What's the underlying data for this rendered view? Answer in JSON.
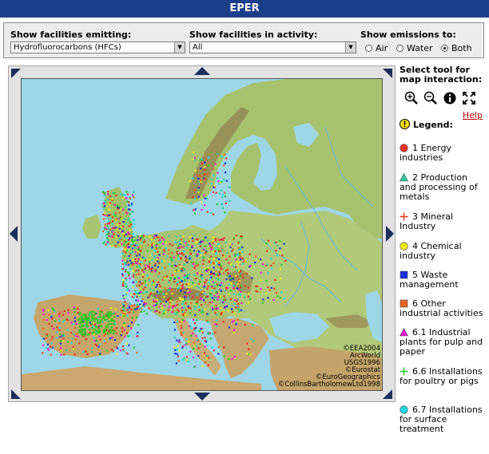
{
  "app": {
    "title": "EPER"
  },
  "filters": {
    "pollutant": {
      "label": "Show facilities emitting:",
      "value": "Hydrofluorocarbons (HFCs)"
    },
    "activity": {
      "label": "Show facilities in activity:",
      "value": "All"
    },
    "emissions": {
      "label": "Show emissions to:",
      "options": [
        "Air",
        "Water",
        "Both"
      ],
      "selected": "Both"
    }
  },
  "map": {
    "credits": [
      "©EEA2004",
      "ArcWorld",
      "USGS1996",
      "©Eurostat",
      "©EuroGeographics",
      "©CollinsBartholomewLtd1998"
    ],
    "colors": {
      "sea": "#9ed6e8",
      "lowland": "#a7c26f",
      "highland": "#c9a873",
      "mountain": "#8c5f3a",
      "river": "#5fb6e4"
    }
  },
  "sidebar": {
    "tool_heading": "Select tool for map interaction:",
    "tools": [
      "zoom-in-icon",
      "zoom-out-icon",
      "info-icon",
      "full-extent-icon"
    ],
    "help_label": "Help",
    "legend_title": "Legend:",
    "legend": [
      {
        "label": "1 Energy industries",
        "symbol": "circle",
        "color": "#e8321e"
      },
      {
        "label": "2 Production and processing of metals",
        "symbol": "triangle",
        "color": "#2ec9a0"
      },
      {
        "label": "3 Mineral Industry",
        "symbol": "plus",
        "color": "#e8321e"
      },
      {
        "label": "4 Chemical industry",
        "symbol": "circle",
        "color": "#f2ee1a"
      },
      {
        "label": "5 Waste management",
        "symbol": "square",
        "color": "#1a2ce0"
      },
      {
        "label": "6 Other industrial activities",
        "symbol": "square",
        "color": "#e8641e"
      },
      {
        "label": "6.1 Industrial plants for pulp and paper",
        "symbol": "triangle",
        "color": "#e41ed0"
      },
      {
        "label": "6.6 Installations for poultry or pigs",
        "symbol": "plus",
        "color": "#22c81e"
      },
      {
        "label": "6.7 Installations for surface treatment",
        "symbol": "circle",
        "color": "#20d8e8"
      }
    ]
  }
}
